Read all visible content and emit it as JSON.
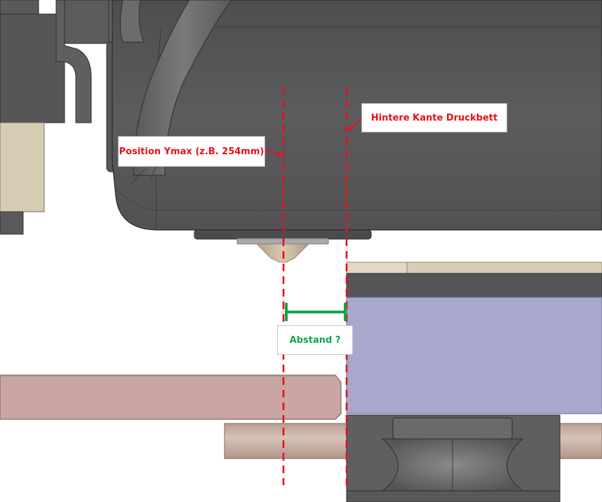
{
  "annotations": {
    "ymax_label": "Position Ymax (z.B. 254mm)",
    "bed_edge_label": "Hintere Kante Druckbett",
    "distance_label": "Abstand ?"
  },
  "colors": {
    "annotation_red": "#e8101a",
    "distance_green": "#11a64a",
    "hotend_body": "#5a5a5c",
    "print_bed": "#a7a8cc",
    "rod_pink": "#c9a6a4",
    "rod_tan": "#cbb3a9"
  }
}
